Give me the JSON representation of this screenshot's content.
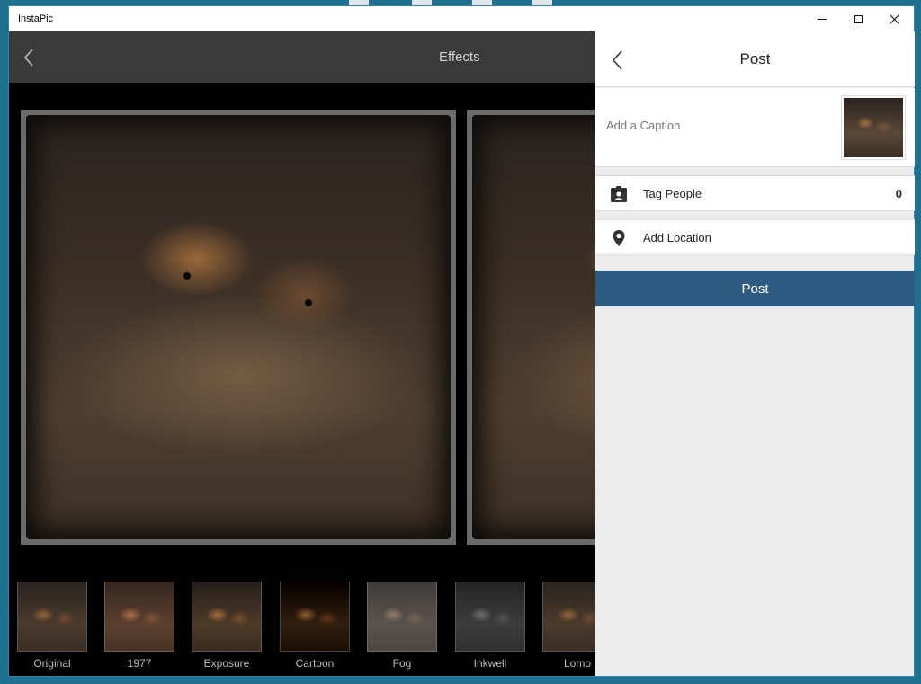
{
  "window": {
    "title": "InstaPic"
  },
  "effects": {
    "title": "Effects",
    "filters": [
      {
        "label": "Original"
      },
      {
        "label": "1977"
      },
      {
        "label": "Exposure"
      },
      {
        "label": "Cartoon"
      },
      {
        "label": "Fog"
      },
      {
        "label": "Inkwell"
      },
      {
        "label": "Lomo"
      }
    ]
  },
  "post": {
    "title": "Post",
    "caption_placeholder": "Add a Caption",
    "tag_people_label": "Tag People",
    "tag_people_count": "0",
    "add_location_label": "Add Location",
    "post_button_label": "Post"
  },
  "icons": {
    "back": "chevron-left-icon",
    "tag": "person-badge-icon",
    "location": "map-pin-icon"
  },
  "colors": {
    "accent": "#2e5b82",
    "panel_bg": "#ececec",
    "desktop": "#1f6f8f"
  }
}
